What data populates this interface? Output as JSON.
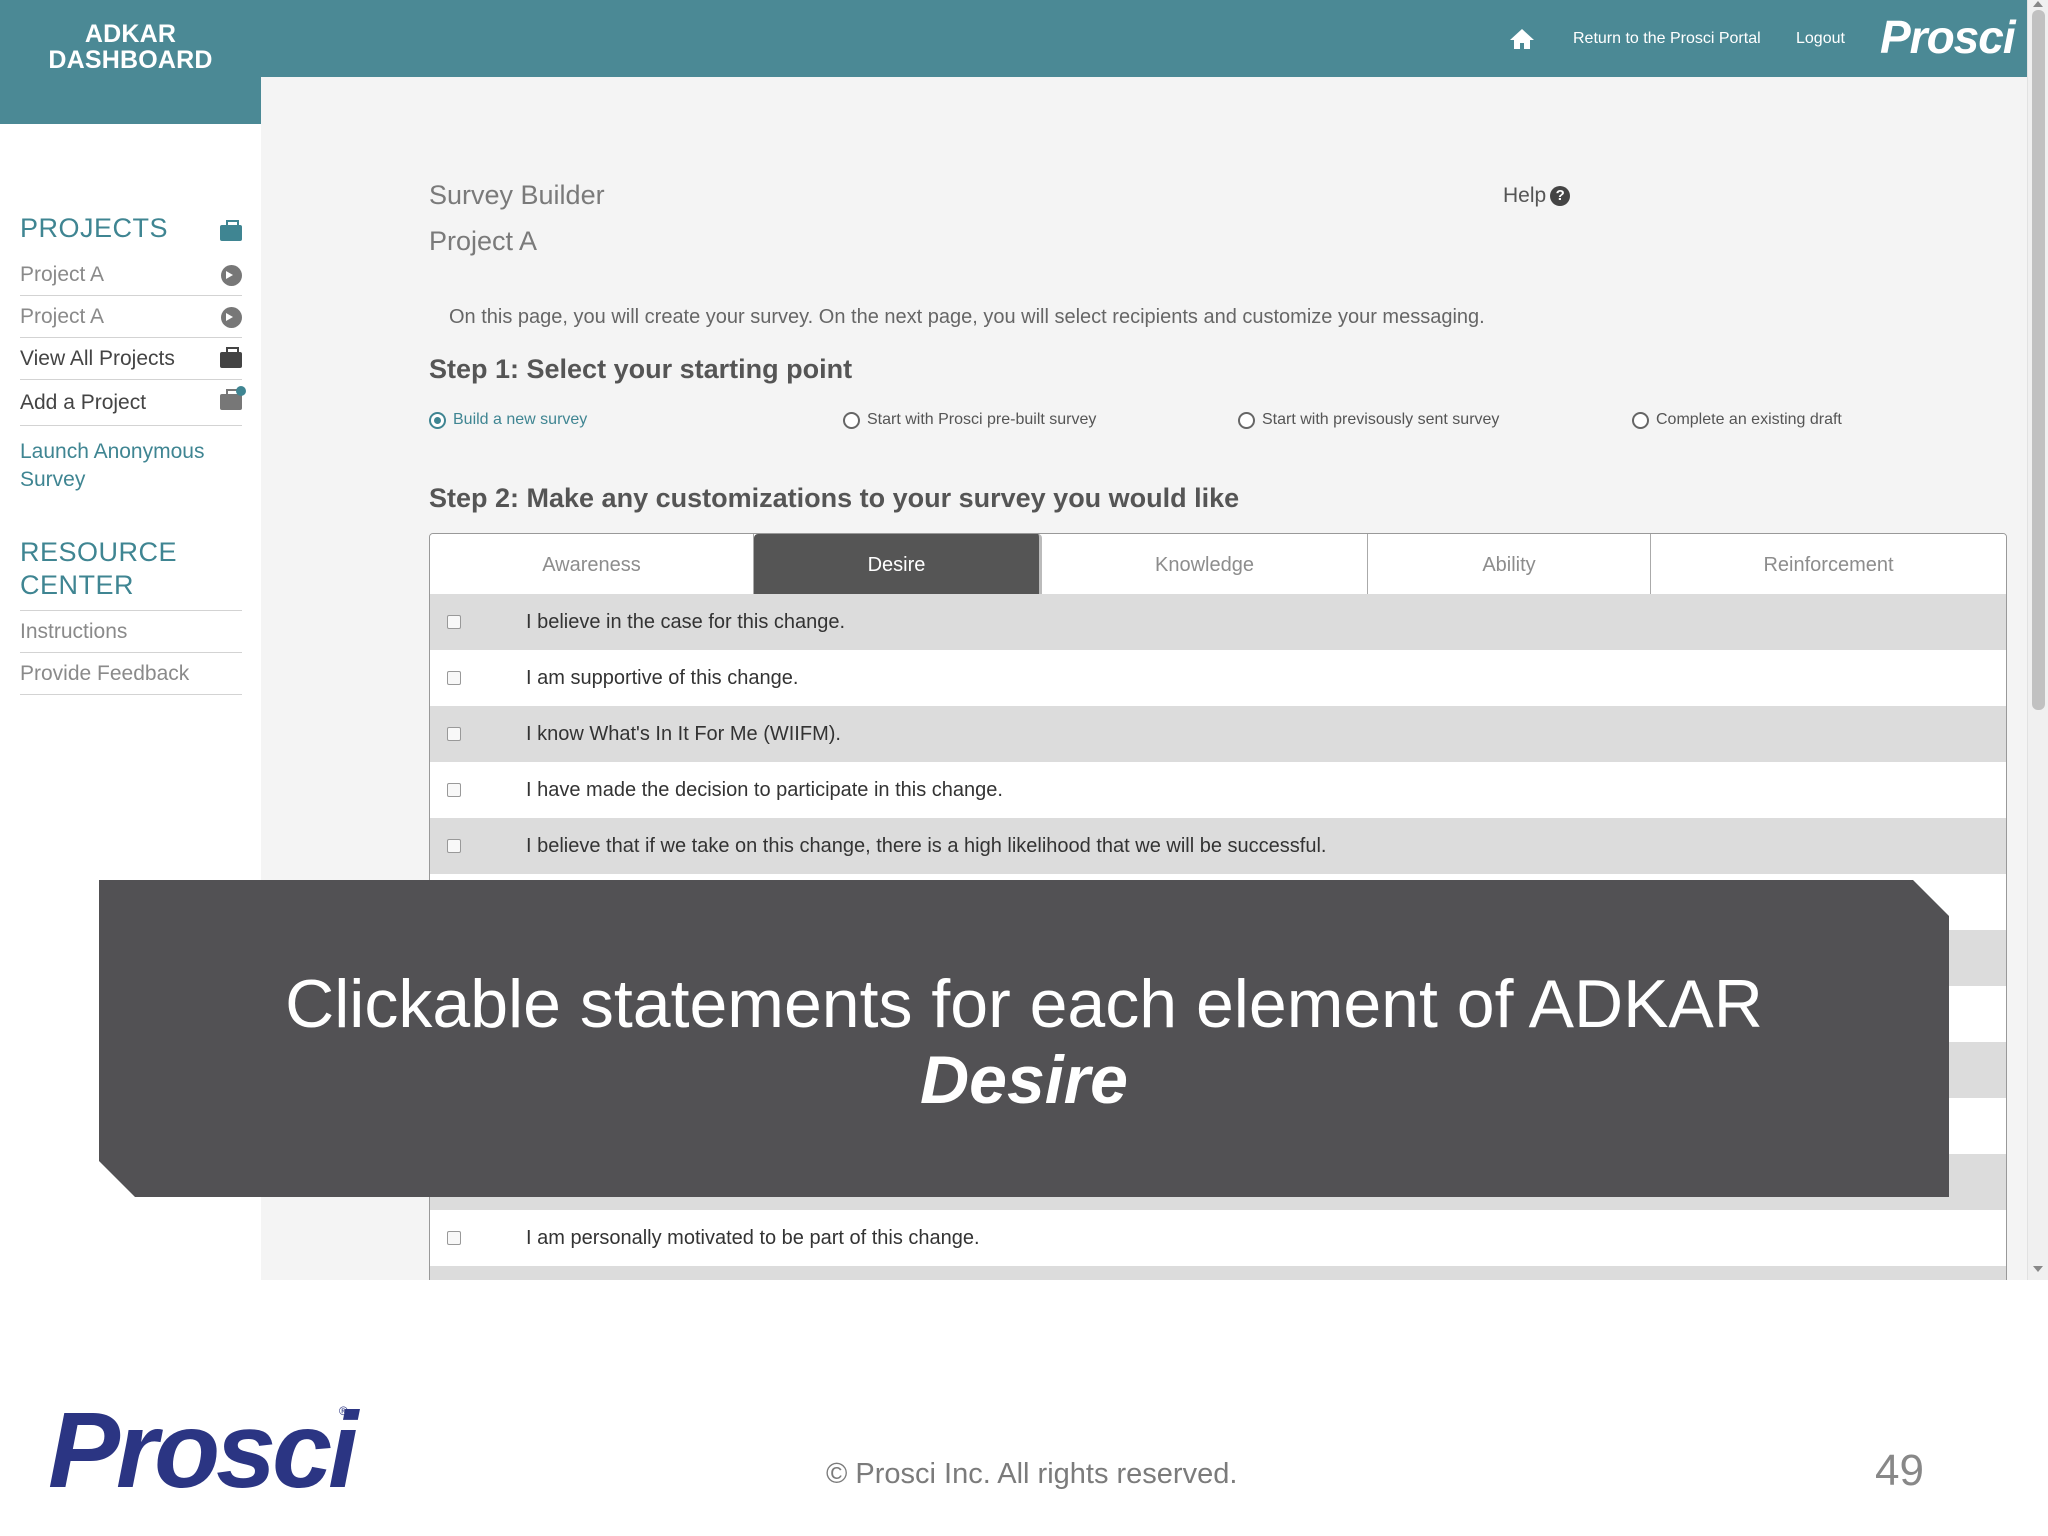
{
  "header": {
    "brand_line1": "ADKAR",
    "brand_line2": "DASHBOARD",
    "home_icon": "home-icon",
    "portal_link": "Return to the Prosci Portal",
    "logout_link": "Logout",
    "logo_text": "Prosci"
  },
  "sidebar": {
    "projects_heading": "PROJECTS",
    "items": [
      {
        "label": "Project A",
        "icon": "circle-arrow-icon"
      },
      {
        "label": "Project A",
        "icon": "circle-arrow-icon"
      },
      {
        "label": "View All Projects",
        "icon": "briefcase-icon"
      },
      {
        "label": "Add a Project",
        "icon": "briefcase-plus-icon"
      }
    ],
    "launch_link": "Launch Anonymous Survey",
    "resource_heading_line1": "RESOURCE",
    "resource_heading_line2": "CENTER",
    "resources": [
      {
        "label": "Instructions"
      },
      {
        "label": "Provide Feedback"
      }
    ]
  },
  "main": {
    "page_title": "Survey Builder",
    "project_name": "Project A",
    "help_label": "Help",
    "help_icon": "?",
    "intro": "On this page, you will create your survey. On the next page, you will select recipients and customize your messaging.",
    "step1_title": "Step 1: Select your starting point",
    "step1_options": [
      {
        "label": "Build a new survey",
        "selected": true
      },
      {
        "label": "Start with Prosci pre-built survey",
        "selected": false
      },
      {
        "label": "Start with previsously sent survey",
        "selected": false
      },
      {
        "label": "Complete an existing draft",
        "selected": false
      }
    ],
    "step2_title": "Step 2: Make any customizations to your survey you would like",
    "tabs": [
      {
        "label": "Awareness",
        "active": false
      },
      {
        "label": "Desire",
        "active": true
      },
      {
        "label": "Knowledge",
        "active": false
      },
      {
        "label": "Ability",
        "active": false
      },
      {
        "label": "Reinforcement",
        "active": false
      }
    ],
    "statements": [
      "I believe in the case for this change.",
      "I am supportive of this change.",
      "I know What's In It For Me (WIIFM).",
      "I have made the decision to participate in this change.",
      "I believe that if we take on this change, there is a high likelihood that we will be successful.",
      "I am personally motivated to be part of this change."
    ]
  },
  "callout": {
    "line1": "Clickable statements for each element of ADKAR",
    "line2": "Desire"
  },
  "footer": {
    "logo_text": "Prosci",
    "registered_mark": "®",
    "copyright": "© Prosci Inc. All rights reserved.",
    "page_number": "49"
  },
  "colors": {
    "header_teal": "#4b8995",
    "accent_teal": "#3f8592",
    "active_tab": "#555555",
    "callout_bg": "#525154",
    "footer_logo": "#2b3583"
  }
}
